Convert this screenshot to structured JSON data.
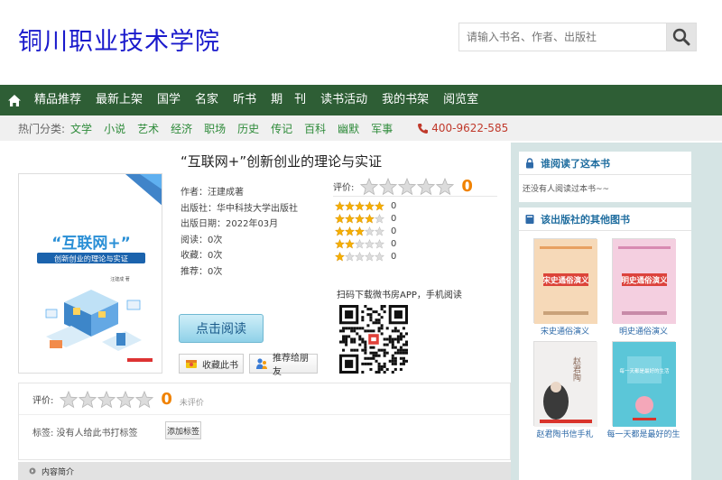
{
  "header": {
    "site_title": "铜川职业技术学院",
    "search_placeholder": "请输入书名、作者、出版社"
  },
  "nav": [
    "精品推荐",
    "最新上架",
    "国学",
    "名家",
    "听书",
    "期　刊",
    "读书活动",
    "我的书架",
    "阅览室"
  ],
  "subnav": {
    "label": "热门分类:",
    "categories": [
      "文学",
      "小说",
      "艺术",
      "经济",
      "职场",
      "历史",
      "传记",
      "百科",
      "幽默",
      "军事"
    ],
    "phone": "400-9622-585"
  },
  "book": {
    "title": "“互联网+”创新创业的理论与实证",
    "cover_title": "“互联网+”",
    "cover_subtitle": "创新创业的理论与实证",
    "cover_author": "汪建成 著",
    "author": "作者：汪建成著",
    "publisher": "出版社：华中科技大学出版社",
    "date": "出版日期：2022年03月",
    "reads": "阅读：0次",
    "favorites": "收藏：0次",
    "recommends": "推荐：0次"
  },
  "rating": {
    "label": "评价:",
    "score": "0",
    "score_fraction": 0,
    "breakdown": [
      {
        "stars": 5,
        "count": "0"
      },
      {
        "stars": 4,
        "count": "0"
      },
      {
        "stars": 3,
        "count": "0"
      },
      {
        "stars": 2,
        "count": "0"
      },
      {
        "stars": 1,
        "count": "0"
      }
    ]
  },
  "qr_label": "扫码下载微书房APP，手机阅读",
  "actions": {
    "read": "点击阅读",
    "favorite": "收藏此书",
    "recommend": "推荐给朋友"
  },
  "review": {
    "label": "评价:",
    "score": "0",
    "status": "未评价",
    "tags": "标签: 没有人给此书打标签",
    "add_tag": "添加标签"
  },
  "intro_label": "内容简介",
  "sidebar": {
    "who_read_title": "谁阅读了这本书",
    "who_read_empty": "还没有人阅读过本书~~",
    "other_books_title": "该出版社的其他图书",
    "other_books": [
      {
        "title": "宋史通俗演义",
        "cover_text": "宋史通俗演义",
        "color": "#f6d9b8"
      },
      {
        "title": "明史通俗演义",
        "cover_text": "明史通俗演义",
        "color": "#f4cfe0"
      },
      {
        "title": "赵君陶书信手札",
        "cover_text": "赵君陶",
        "color": "#f1efee"
      },
      {
        "title": "每一天都是最好的生",
        "cover_text": "每一天都是最好的生活",
        "color": "#5bc6d8"
      }
    ]
  },
  "colors": {
    "nav_bg": "#2e5e35",
    "title_blue": "#1a1acc",
    "accent_orange": "#f08200",
    "category_green": "#2e8b3a",
    "phone_red": "#c0392b",
    "sidebar_bg": "#d5e4e4"
  }
}
